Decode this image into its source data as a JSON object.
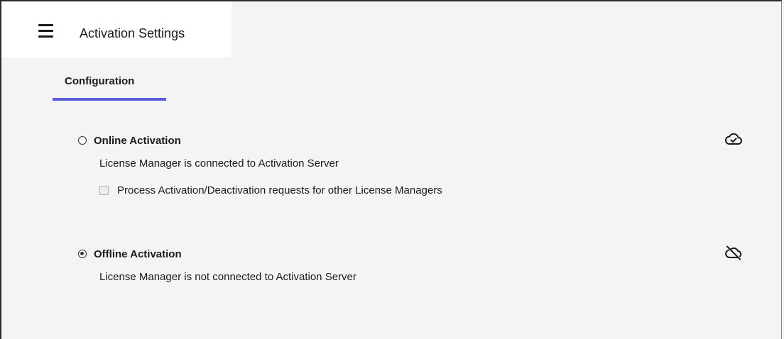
{
  "header": {
    "menu_icon": "hamburger-menu-icon",
    "title": "Activation Settings"
  },
  "tabs": [
    {
      "label": "Configuration",
      "active": true
    }
  ],
  "options": {
    "online": {
      "label": "Online Activation",
      "selected": false,
      "description": "License Manager is connected to Activation Server",
      "checkbox": {
        "label": "Process Activation/Deactivation requests for other License Managers",
        "checked": false,
        "disabled": true
      },
      "status_icon": "cloud-check-icon"
    },
    "offline": {
      "label": "Offline Activation",
      "selected": true,
      "description": "License Manager is not connected to Activation Server",
      "status_icon": "cloud-off-icon"
    }
  },
  "colors": {
    "accent": "#5a5cde",
    "background": "#f4f4f4",
    "header_background": "#ffffff"
  }
}
